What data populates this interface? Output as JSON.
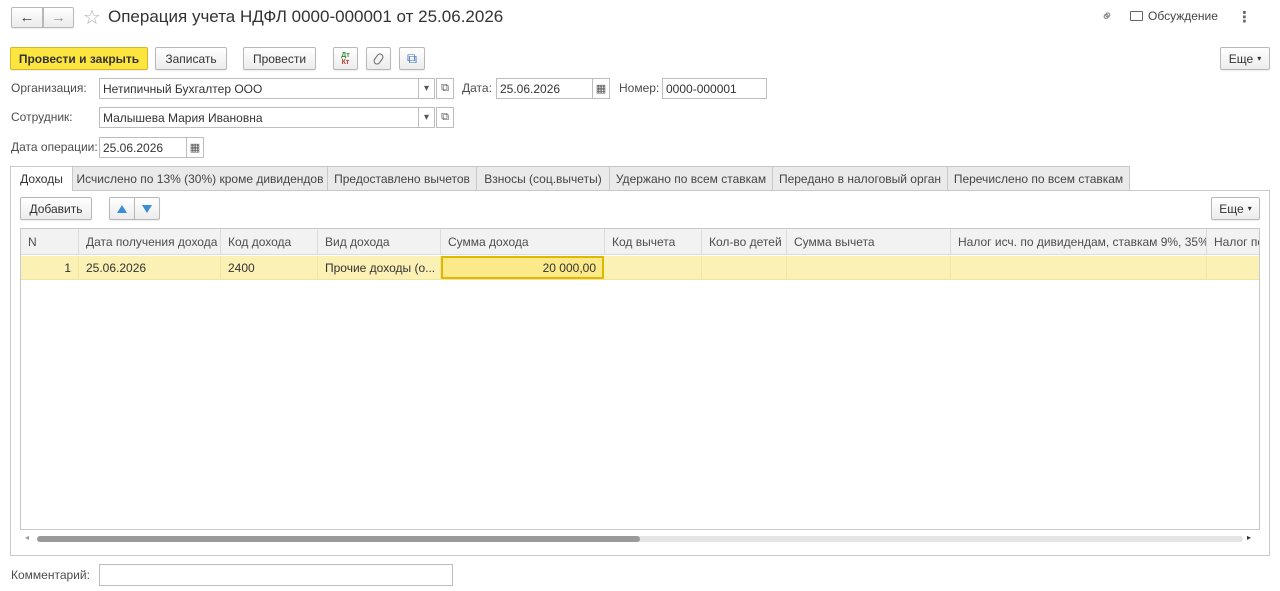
{
  "header": {
    "back_glyph": "←",
    "forward_glyph": "→",
    "star_glyph": "☆",
    "title": "Операция учета НДФЛ 0000-000001 от 25.06.2026",
    "link_glyph": "⚭",
    "discussion_label": "Обсуждение",
    "more_glyph": "⋮"
  },
  "toolbar": {
    "post_close_label": "Провести и закрыть",
    "save_label": "Записать",
    "post_label": "Провести",
    "dt_kt_glyph_top": "Дт",
    "dt_kt_glyph_bottom": "Кт",
    "attach_glyph": "📎",
    "struct_glyph": "⧉",
    "more_label": "Еще"
  },
  "form": {
    "org_label": "Организация:",
    "org_value": "Нетипичный Бухгалтер ООО",
    "date_label": "Дата:",
    "date_value": "25.06.2026",
    "number_label": "Номер:",
    "number_value": "0000-000001",
    "employee_label": "Сотрудник:",
    "employee_value": "Малышева Мария Ивановна",
    "op_date_label": "Дата операции:",
    "op_date_value": "25.06.2026",
    "dropdown_glyph": "▾",
    "open_glyph": "⧉",
    "calendar_glyph": "▦"
  },
  "tabs": [
    {
      "label": "Доходы"
    },
    {
      "label": "Исчислено по 13% (30%) кроме дивидендов"
    },
    {
      "label": "Предоставлено вычетов"
    },
    {
      "label": "Взносы (соц.вычеты)"
    },
    {
      "label": "Удержано по всем ставкам"
    },
    {
      "label": "Передано в налоговый орган"
    },
    {
      "label": "Перечислено по всем ставкам"
    }
  ],
  "table_toolbar": {
    "add_label": "Добавить",
    "up_glyph": "🡅",
    "down_glyph": "🡇",
    "more_label": "Еще"
  },
  "table": {
    "columns": [
      "N",
      "Дата получения дохода",
      "Код дохода",
      "Вид дохода",
      "Сумма дохода",
      "Код вычета",
      "Кол-во детей",
      "Сумма вычета",
      "Налог исч. по дивидендам, ставкам 9%, 35%",
      "Налог по"
    ],
    "rows": [
      [
        "1",
        "25.06.2026",
        "2400",
        "Прочие доходы (о...",
        "20 000,00",
        "",
        "",
        "",
        "",
        ""
      ]
    ]
  },
  "comment": {
    "label": "Комментарий:",
    "value": ""
  },
  "colors": {
    "primary_button": "#fce53e",
    "selected_row": "#fbf1b4",
    "active_cell_border": "#e0b800",
    "arrow_blue": "#3a8ed6"
  }
}
